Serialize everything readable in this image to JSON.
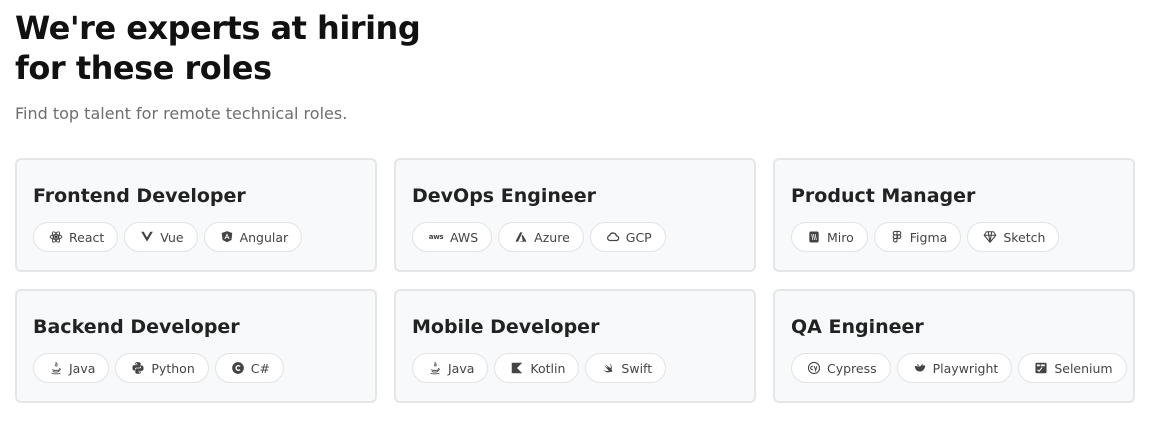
{
  "header": {
    "title_line1": "We're experts at hiring",
    "title_line2": "for these roles",
    "subtitle": "Find top talent for remote technical roles."
  },
  "roles": [
    {
      "title": "Frontend Developer",
      "skills": [
        {
          "label": "React",
          "icon": "react-icon"
        },
        {
          "label": "Vue",
          "icon": "vue-icon"
        },
        {
          "label": "Angular",
          "icon": "angular-icon"
        }
      ]
    },
    {
      "title": "DevOps Engineer",
      "skills": [
        {
          "label": "AWS",
          "icon": "aws-icon",
          "icon_text": "aws"
        },
        {
          "label": "Azure",
          "icon": "azure-icon"
        },
        {
          "label": "GCP",
          "icon": "gcp-cloud-icon"
        }
      ]
    },
    {
      "title": "Product Manager",
      "skills": [
        {
          "label": "Miro",
          "icon": "miro-icon"
        },
        {
          "label": "Figma",
          "icon": "figma-icon"
        },
        {
          "label": "Sketch",
          "icon": "sketch-icon"
        }
      ]
    },
    {
      "title": "Backend Developer",
      "skills": [
        {
          "label": "Java",
          "icon": "java-icon"
        },
        {
          "label": "Python",
          "icon": "python-icon"
        },
        {
          "label": "C#",
          "icon": "csharp-icon"
        }
      ]
    },
    {
      "title": "Mobile Developer",
      "skills": [
        {
          "label": "Java",
          "icon": "java-icon"
        },
        {
          "label": "Kotlin",
          "icon": "kotlin-icon"
        },
        {
          "label": "Swift",
          "icon": "swift-icon"
        }
      ]
    },
    {
      "title": "QA Engineer",
      "skills": [
        {
          "label": "Cypress",
          "icon": "cypress-icon"
        },
        {
          "label": "Playwright",
          "icon": "playwright-icon"
        },
        {
          "label": "Selenium",
          "icon": "selenium-icon"
        }
      ]
    }
  ]
}
